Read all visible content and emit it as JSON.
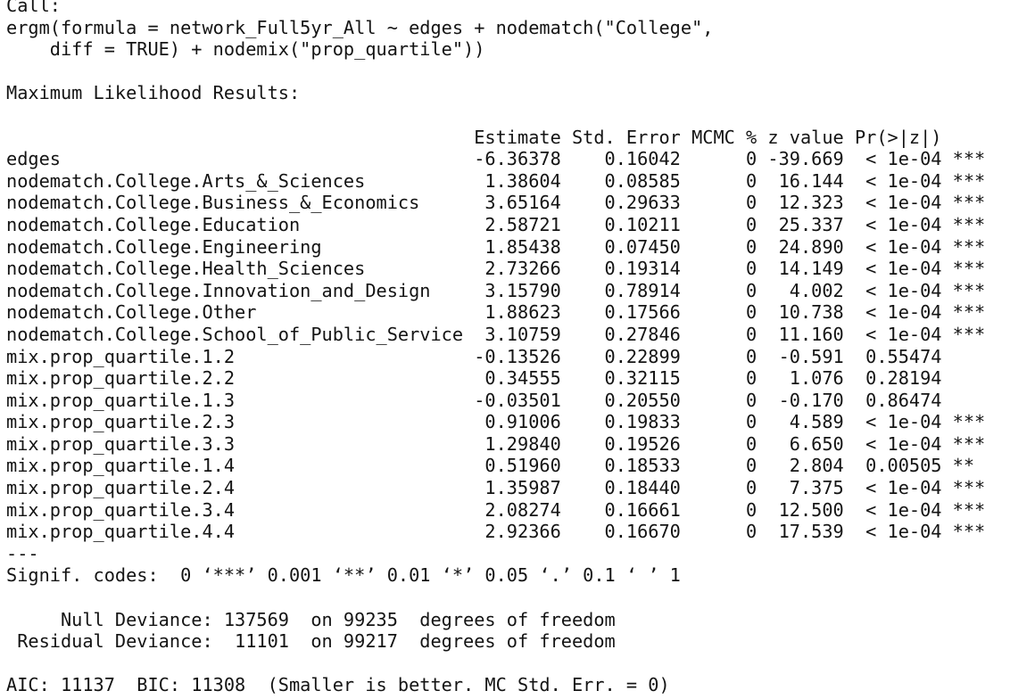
{
  "console": {
    "lines": [
      "Call:",
      "ergm(formula = network_Full5yr_All ~ edges + nodematch(\"College\",",
      "    diff = TRUE) + nodemix(\"prop_quartile\"))",
      "",
      "Maximum Likelihood Results:",
      "",
      "                                           Estimate Std. Error MCMC % z value Pr(>|z|)    ",
      "edges                                      -6.36378    0.16042      0 -39.669  < 1e-04 ***",
      "nodematch.College.Arts_&_Sciences           1.38604    0.08585      0  16.144  < 1e-04 ***",
      "nodematch.College.Business_&_Economics      3.65164    0.29633      0  12.323  < 1e-04 ***",
      "nodematch.College.Education                 2.58721    0.10211      0  25.337  < 1e-04 ***",
      "nodematch.College.Engineering               1.85438    0.07450      0  24.890  < 1e-04 ***",
      "nodematch.College.Health_Sciences           2.73266    0.19314      0  14.149  < 1e-04 ***",
      "nodematch.College.Innovation_and_Design     3.15790    0.78914      0   4.002  < 1e-04 ***",
      "nodematch.College.Other                     1.88623    0.17566      0  10.738  < 1e-04 ***",
      "nodematch.College.School_of_Public_Service  3.10759    0.27846      0  11.160  < 1e-04 ***",
      "mix.prop_quartile.1.2                      -0.13526    0.22899      0  -0.591  0.55474    ",
      "mix.prop_quartile.2.2                       0.34555    0.32115      0   1.076  0.28194    ",
      "mix.prop_quartile.1.3                      -0.03501    0.20550      0  -0.170  0.86474    ",
      "mix.prop_quartile.2.3                       0.91006    0.19833      0   4.589  < 1e-04 ***",
      "mix.prop_quartile.3.3                       1.29840    0.19526      0   6.650  < 1e-04 ***",
      "mix.prop_quartile.1.4                       0.51960    0.18533      0   2.804  0.00505 ** ",
      "mix.prop_quartile.2.4                       1.35987    0.18440      0   7.375  < 1e-04 ***",
      "mix.prop_quartile.3.4                       2.08274    0.16661      0  12.500  < 1e-04 ***",
      "mix.prop_quartile.4.4                       2.92366    0.16670      0  17.539  < 1e-04 ***",
      "---",
      "Signif. codes:  0 ‘***’ 0.001 ‘**’ 0.01 ‘*’ 0.05 ‘.’ 0.1 ‘ ’ 1",
      "",
      "     Null Deviance: 137569  on 99235  degrees of freedom",
      " Residual Deviance:  11101  on 99217  degrees of freedom",
      "",
      "AIC: 11137  BIC: 11308  (Smaller is better. MC Std. Err. = 0)"
    ]
  }
}
